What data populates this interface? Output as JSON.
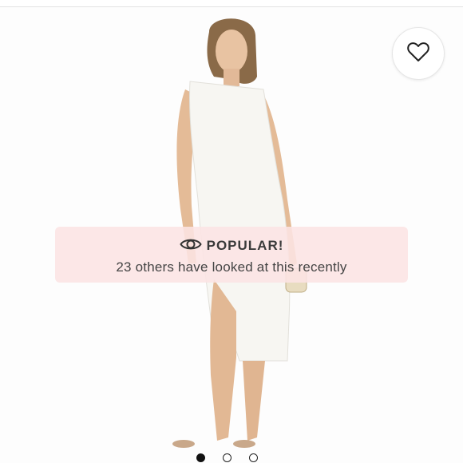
{
  "banner": {
    "title": "POPULAR!",
    "subtitle": "23 others have looked at this recently"
  },
  "icons": {
    "favorite": "heart-icon",
    "views": "eye-icon"
  },
  "carousel": {
    "slide_count": 3,
    "active_index": 0
  },
  "colors": {
    "banner_bg": "#fce4e4",
    "dress": "#f7f6f2",
    "text": "#3a3a3a"
  }
}
